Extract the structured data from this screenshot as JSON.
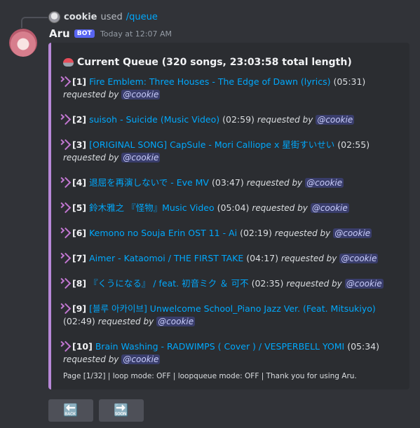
{
  "reply": {
    "user": "cookie",
    "used": "used",
    "command": "/queue"
  },
  "message": {
    "author": "Aru",
    "badge": "BOT",
    "timestamp": "Today at 12:07 AM"
  },
  "embed": {
    "title": "Current Queue (320 songs, 23:03:58 total length)",
    "accent_color": "#b888d8",
    "entries": [
      {
        "num": "[1]",
        "song": "Fire Emblem: Three Houses - The Edge of Dawn (lyrics)",
        "duration": "(05:31)",
        "requested": "requested by",
        "user": "@cookie"
      },
      {
        "num": "[2]",
        "song": "suisoh - Suicide (Music Video)",
        "duration": "(02:59)",
        "requested": "requested by",
        "user": "@cookie"
      },
      {
        "num": "[3]",
        "song": "[ORIGINAL SONG] CapSule - Mori Calliope x 星街すいせい",
        "duration": "(02:55)",
        "requested": "requested by",
        "user": "@cookie"
      },
      {
        "num": "[4]",
        "song": "退屈を再演しないで - Eve MV",
        "duration": "(03:47)",
        "requested": "requested by",
        "user": "@cookie"
      },
      {
        "num": "[5]",
        "song": "鈴木雅之 『怪物』Music Video",
        "duration": "(05:04)",
        "requested": "requested by",
        "user": "@cookie"
      },
      {
        "num": "[6]",
        "song": "Kemono no Souja Erin OST 11 - Ai",
        "duration": "(02:19)",
        "requested": "requested by",
        "user": "@cookie"
      },
      {
        "num": "[7]",
        "song": "Aimer - Kataomoi / THE FIRST TAKE",
        "duration": "(04:17)",
        "requested": "requested by",
        "user": "@cookie"
      },
      {
        "num": "[8]",
        "song": "『くうになる』 / feat. 初音ミク ＆ 可不",
        "duration": "(02:35)",
        "requested": "requested by",
        "user": "@cookie"
      },
      {
        "num": "[9]",
        "song": "[블루 아카이브] Unwelcome School_Piano Jazz Ver. (Feat. Mitsukiyo)",
        "duration": "(02:49)",
        "requested": "requested by",
        "user": "@cookie"
      },
      {
        "num": "[10]",
        "song": "Brain Washing - RADWIMPS ( Cover ) / VESPERBELL YOMI",
        "duration": "(05:34)",
        "requested": "requested by",
        "user": "@cookie"
      }
    ],
    "footer": "Page [1/32] | loop mode: OFF | loopqueue mode: OFF | Thank you for using Aru."
  },
  "buttons": {
    "back_icon": "back-arrow-emoji",
    "next_icon": "forward-arrow-emoji",
    "back_glyph": "🔙",
    "next_glyph": "🔜"
  }
}
